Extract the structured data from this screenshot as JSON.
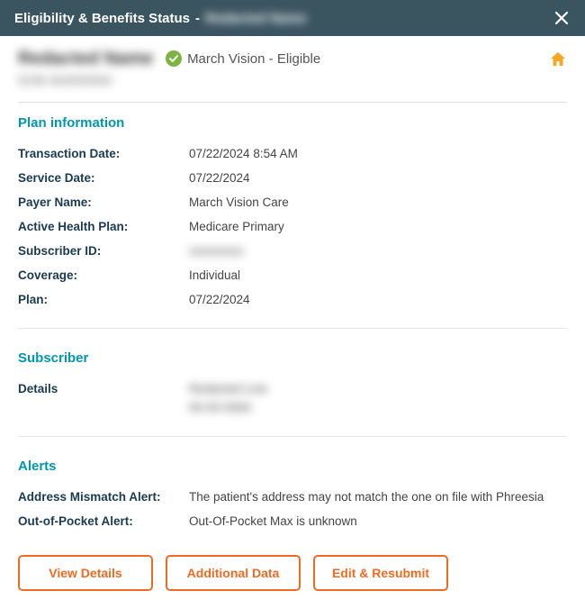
{
  "titlebar": {
    "title": "Eligibility & Benefits Status",
    "separator": "-",
    "patient_name_masked": "Redacted Name"
  },
  "header": {
    "patient_name_masked": "Redacted Name",
    "dob_label_masked": "DOB",
    "dob_value_masked": "00/00/0000",
    "status_text": "March Vision - Eligible"
  },
  "sections": {
    "plan_info": {
      "title": "Plan information",
      "rows": {
        "transaction_date": {
          "label": "Transaction Date:",
          "value": "07/22/2024 8:54 AM"
        },
        "service_date": {
          "label": "Service Date:",
          "value": "07/22/2024"
        },
        "payer_name": {
          "label": "Payer Name:",
          "value": "March Vision Care"
        },
        "active_plan": {
          "label": "Active Health Plan:",
          "value": "Medicare Primary"
        },
        "subscriber_id": {
          "label": "Subscriber ID:",
          "value_masked": "xxxxxxxxx"
        },
        "coverage": {
          "label": "Coverage:",
          "value": "Individual"
        },
        "plan": {
          "label": "Plan:",
          "value": "07/22/2024"
        }
      }
    },
    "subscriber": {
      "title": "Subscriber",
      "rows": {
        "details": {
          "label": "Details",
          "value1_masked": "Redacted Line",
          "value2_masked": "00-00-0000"
        }
      }
    },
    "alerts": {
      "title": "Alerts",
      "rows": {
        "address_mismatch": {
          "label": "Address Mismatch Alert:",
          "value": "The patient's address may not match the one on file with Phreesia"
        },
        "oop": {
          "label": "Out-of-Pocket Alert:",
          "value": "Out-Of-Pocket Max is unknown"
        }
      }
    }
  },
  "buttons": {
    "view_details": "View Details",
    "additional_data": "Additional Data",
    "edit_resubmit": "Edit & Resubmit"
  }
}
